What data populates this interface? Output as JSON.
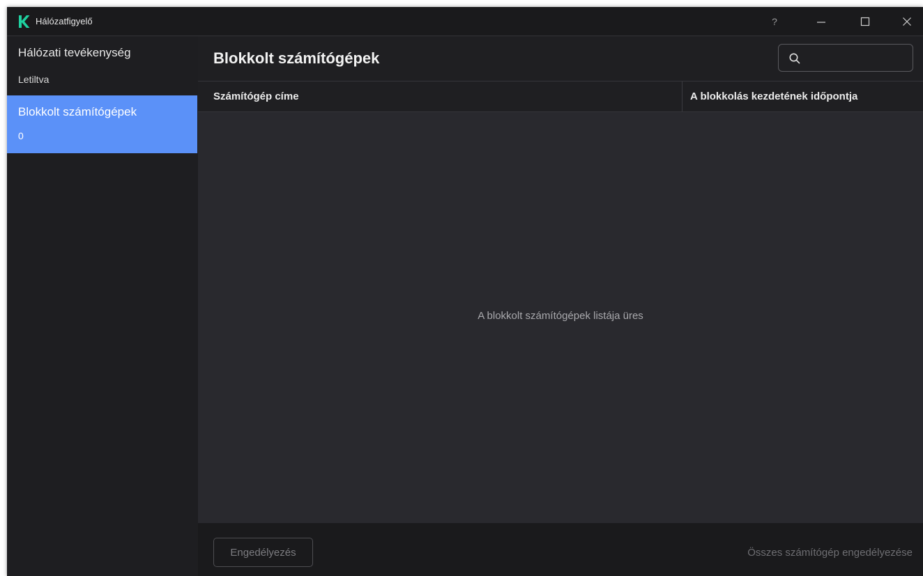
{
  "window": {
    "title": "Hálózatfigyelő",
    "help_label": "?",
    "accent_color": "#5b91f8",
    "logo_color": "#1fd1a0"
  },
  "sidebar": {
    "items": [
      {
        "title": "Hálózati tevékenység",
        "subtitle": "Letiltva",
        "selected": false
      },
      {
        "title": "Blokkolt számítógépek",
        "subtitle": "0",
        "selected": true
      }
    ]
  },
  "main": {
    "title": "Blokkolt számítógépek",
    "search": {
      "value": "",
      "icon": "search-icon"
    },
    "columns": [
      "Számítógép címe",
      "A blokkolás kezdetének időpontja"
    ],
    "empty_message": "A blokkolt számítógépek listája üres",
    "footer": {
      "allow_label": "Engedélyezés",
      "allow_all_label": "Összes számítógép engedélyezése"
    }
  }
}
